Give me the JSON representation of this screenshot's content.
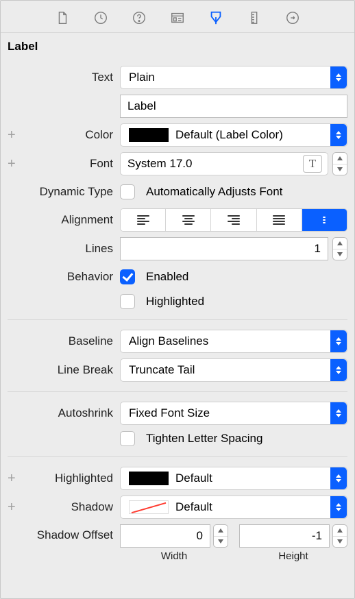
{
  "section": "Label",
  "text": {
    "label": "Text",
    "value": "Plain"
  },
  "textField": {
    "value": "Label"
  },
  "color": {
    "label": "Color",
    "value": "Default (Label Color)"
  },
  "font": {
    "label": "Font",
    "value": "System 17.0"
  },
  "dynamicType": {
    "label": "Dynamic Type",
    "checkbox": "Automatically Adjusts Font"
  },
  "alignment": {
    "label": "Alignment"
  },
  "lines": {
    "label": "Lines",
    "value": "1"
  },
  "behavior": {
    "label": "Behavior",
    "enabled": "Enabled",
    "highlighted": "Highlighted"
  },
  "baseline": {
    "label": "Baseline",
    "value": "Align Baselines"
  },
  "lineBreak": {
    "label": "Line Break",
    "value": "Truncate Tail"
  },
  "autoshrink": {
    "label": "Autoshrink",
    "value": "Fixed Font Size",
    "tighten": "Tighten Letter Spacing"
  },
  "highlightedColor": {
    "label": "Highlighted",
    "value": "Default"
  },
  "shadow": {
    "label": "Shadow",
    "value": "Default"
  },
  "shadowOffset": {
    "label": "Shadow Offset",
    "width": "0",
    "height": "-1",
    "widthLabel": "Width",
    "heightLabel": "Height"
  }
}
